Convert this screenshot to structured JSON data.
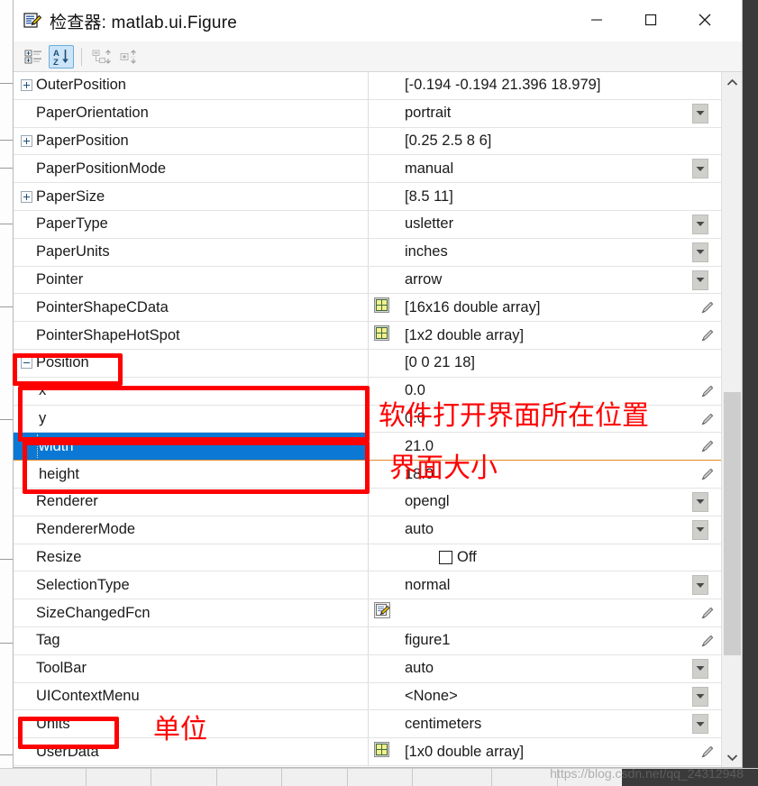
{
  "window": {
    "title": "检查器: matlab.ui.Figure",
    "icon": "inspector-document-brush-icon",
    "minimize_label": "—",
    "maximize_label": "□",
    "close_label": "✕"
  },
  "toolbar": {
    "buttons": [
      {
        "name": "categorized-view-button",
        "label": "categorize-icon",
        "active": false,
        "enabled": true
      },
      {
        "name": "alphabetical-sort-button",
        "label": "sort-az-icon",
        "active": true,
        "enabled": true
      },
      {
        "name": "collapse-all-button",
        "label": "collapse-all-icon",
        "active": false,
        "enabled": false
      },
      {
        "name": "expand-all-button",
        "label": "expand-all-icon",
        "active": false,
        "enabled": false
      }
    ]
  },
  "grid": {
    "rows": [
      {
        "name": "OuterPosition",
        "value": "[-0.194 -0.194 21.396 18.979]",
        "expander": "plus",
        "indent": 0,
        "dropdown": false,
        "pencil": false,
        "icon": null,
        "checkbox": false,
        "selected": false
      },
      {
        "name": "PaperOrientation",
        "value": "portrait",
        "expander": null,
        "indent": 0,
        "dropdown": true,
        "pencil": false,
        "icon": null,
        "checkbox": false,
        "selected": false
      },
      {
        "name": "PaperPosition",
        "value": "[0.25 2.5 8 6]",
        "expander": "plus",
        "indent": 0,
        "dropdown": false,
        "pencil": false,
        "icon": null,
        "checkbox": false,
        "selected": false
      },
      {
        "name": "PaperPositionMode",
        "value": "manual",
        "expander": null,
        "indent": 0,
        "dropdown": true,
        "pencil": false,
        "icon": null,
        "checkbox": false,
        "selected": false
      },
      {
        "name": "PaperSize",
        "value": "[8.5 11]",
        "expander": "plus",
        "indent": 0,
        "dropdown": false,
        "pencil": false,
        "icon": null,
        "checkbox": false,
        "selected": false
      },
      {
        "name": "PaperType",
        "value": "usletter",
        "expander": null,
        "indent": 0,
        "dropdown": true,
        "pencil": false,
        "icon": null,
        "checkbox": false,
        "selected": false
      },
      {
        "name": "PaperUnits",
        "value": "inches",
        "expander": null,
        "indent": 0,
        "dropdown": true,
        "pencil": false,
        "icon": null,
        "checkbox": false,
        "selected": false
      },
      {
        "name": "Pointer",
        "value": "arrow",
        "expander": null,
        "indent": 0,
        "dropdown": true,
        "pencil": false,
        "icon": null,
        "checkbox": false,
        "selected": false
      },
      {
        "name": "PointerShapeCData",
        "value": "[16x16  double array]",
        "expander": null,
        "indent": 0,
        "dropdown": false,
        "pencil": true,
        "icon": "array-grid-icon",
        "checkbox": false,
        "selected": false
      },
      {
        "name": "PointerShapeHotSpot",
        "value": "[1x2  double array]",
        "expander": null,
        "indent": 0,
        "dropdown": false,
        "pencil": true,
        "icon": "array-grid-icon",
        "checkbox": false,
        "selected": false
      },
      {
        "name": "Position",
        "value": "[0 0 21 18]",
        "expander": "minus",
        "indent": 0,
        "dropdown": false,
        "pencil": false,
        "icon": null,
        "checkbox": false,
        "selected": false
      },
      {
        "name": "x",
        "value": "0.0",
        "expander": null,
        "indent": 1,
        "dropdown": false,
        "pencil": true,
        "icon": null,
        "checkbox": false,
        "selected": false
      },
      {
        "name": "y",
        "value": "0.0",
        "expander": null,
        "indent": 1,
        "dropdown": false,
        "pencil": true,
        "icon": null,
        "checkbox": false,
        "selected": false
      },
      {
        "name": "width",
        "value": "21.0",
        "expander": null,
        "indent": 1,
        "dropdown": false,
        "pencil": true,
        "icon": null,
        "checkbox": false,
        "selected": true
      },
      {
        "name": "height",
        "value": "18.0",
        "expander": null,
        "indent": 1,
        "dropdown": false,
        "pencil": true,
        "icon": null,
        "checkbox": false,
        "selected": false
      },
      {
        "name": "Renderer",
        "value": "opengl",
        "expander": null,
        "indent": 0,
        "dropdown": true,
        "pencil": false,
        "icon": null,
        "checkbox": false,
        "selected": false
      },
      {
        "name": "RendererMode",
        "value": "auto",
        "expander": null,
        "indent": 0,
        "dropdown": true,
        "pencil": false,
        "icon": null,
        "checkbox": false,
        "selected": false
      },
      {
        "name": "Resize",
        "value": "Off",
        "expander": null,
        "indent": 0,
        "dropdown": false,
        "pencil": false,
        "icon": null,
        "checkbox": true,
        "selected": false
      },
      {
        "name": "SelectionType",
        "value": "normal",
        "expander": null,
        "indent": 0,
        "dropdown": true,
        "pencil": false,
        "icon": null,
        "checkbox": false,
        "selected": false
      },
      {
        "name": "SizeChangedFcn",
        "value": "",
        "expander": null,
        "indent": 0,
        "dropdown": false,
        "pencil": true,
        "icon": "function-handle-icon",
        "checkbox": false,
        "selected": false
      },
      {
        "name": "Tag",
        "value": "figure1",
        "expander": null,
        "indent": 0,
        "dropdown": false,
        "pencil": true,
        "icon": null,
        "checkbox": false,
        "selected": false
      },
      {
        "name": "ToolBar",
        "value": "auto",
        "expander": null,
        "indent": 0,
        "dropdown": true,
        "pencil": false,
        "icon": null,
        "checkbox": false,
        "selected": false
      },
      {
        "name": "UIContextMenu",
        "value": "<None>",
        "expander": null,
        "indent": 0,
        "dropdown": true,
        "pencil": false,
        "icon": null,
        "checkbox": false,
        "selected": false
      },
      {
        "name": "Units",
        "value": "centimeters",
        "expander": null,
        "indent": 0,
        "dropdown": true,
        "pencil": false,
        "icon": null,
        "checkbox": false,
        "selected": false
      },
      {
        "name": "UserData",
        "value": "[1x0  double array]",
        "expander": null,
        "indent": 0,
        "dropdown": false,
        "pencil": true,
        "icon": "array-grid-icon",
        "checkbox": false,
        "selected": false
      }
    ]
  },
  "scrollbar": {
    "up_arrow": "chevron-up-icon",
    "down_arrow": "chevron-down-icon"
  },
  "annotations": {
    "color": "#ff0000",
    "position_label": "软件打开界面所在位置",
    "size_label": "界面大小",
    "units_label": "单位"
  },
  "watermark": "https://blog.csdn.net/qq_24312948"
}
